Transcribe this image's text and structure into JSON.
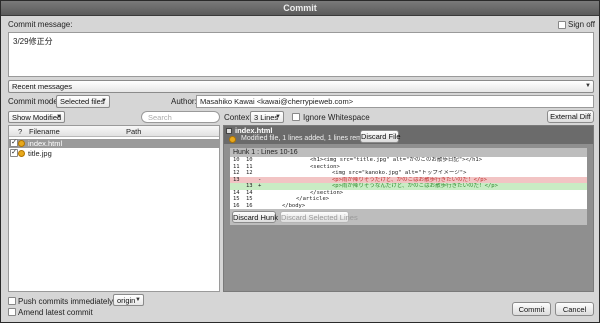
{
  "window": {
    "title": "Commit"
  },
  "commit_message": {
    "label": "Commit message:",
    "sign_off_label": "Sign off",
    "text": "3/29修正分",
    "recent_messages": "Recent messages"
  },
  "commit_mode": {
    "label": "Commit mode:",
    "value": "Selected files"
  },
  "author": {
    "label": "Author:",
    "value": "Masahiko Kawai <kawai@cherrypieweb.com>"
  },
  "file_list": {
    "filter": "Show Modified",
    "search_placeholder": "Search",
    "columns": [
      "?",
      "Filename",
      "Path"
    ],
    "files": [
      {
        "name": "index.html",
        "selected": true
      },
      {
        "name": "title.jpg",
        "selected": false
      }
    ]
  },
  "diff": {
    "context_label": "Context:",
    "context_value": "3 Lines",
    "ignore_whitespace": "Ignore Whitespace",
    "external_diff": "External Diff",
    "file_name": "index.html",
    "file_status": "Modified file, 1 lines added, 1 lines removed",
    "discard_file": "Discard File",
    "hunk_header": "Hunk 1 : Lines 10-16",
    "lines": [
      {
        "old": "10",
        "new": "10",
        "mark": "",
        "type": "ctx",
        "text": "<h1><img src=\"title.jpg\" alt=\"かのこのお散歩日記\"></h1>"
      },
      {
        "old": "11",
        "new": "11",
        "mark": "",
        "type": "ctx",
        "text": "<section>"
      },
      {
        "old": "12",
        "new": "12",
        "mark": "",
        "type": "ctx",
        "text": "<img src=\"kanoko.jpg\" alt=\"トップイメージ\">"
      },
      {
        "old": "13",
        "new": "",
        "mark": "-",
        "type": "del",
        "text": "<p>雨が降りそうだけど、かのこはお散歩行きたいのだ！</p>"
      },
      {
        "old": "",
        "new": "13",
        "mark": "+",
        "type": "add",
        "text": "<p>雨が降りそうなんだけど、かのこはお散歩行きたいのだ！</p>"
      },
      {
        "old": "14",
        "new": "14",
        "mark": "",
        "type": "ctx",
        "text": "</section>"
      },
      {
        "old": "15",
        "new": "15",
        "mark": "",
        "type": "ctx",
        "text": "</article>"
      },
      {
        "old": "16",
        "new": "16",
        "mark": "",
        "type": "ctx",
        "text": "</body>"
      }
    ],
    "discard_hunk": "Discard Hunk",
    "discard_selected": "Discard Selected Lines"
  },
  "footer": {
    "push_label": "Push commits immediately to:",
    "remote": "origin",
    "amend_label": "Amend latest commit",
    "commit_button": "Commit",
    "cancel_button": "Cancel"
  }
}
